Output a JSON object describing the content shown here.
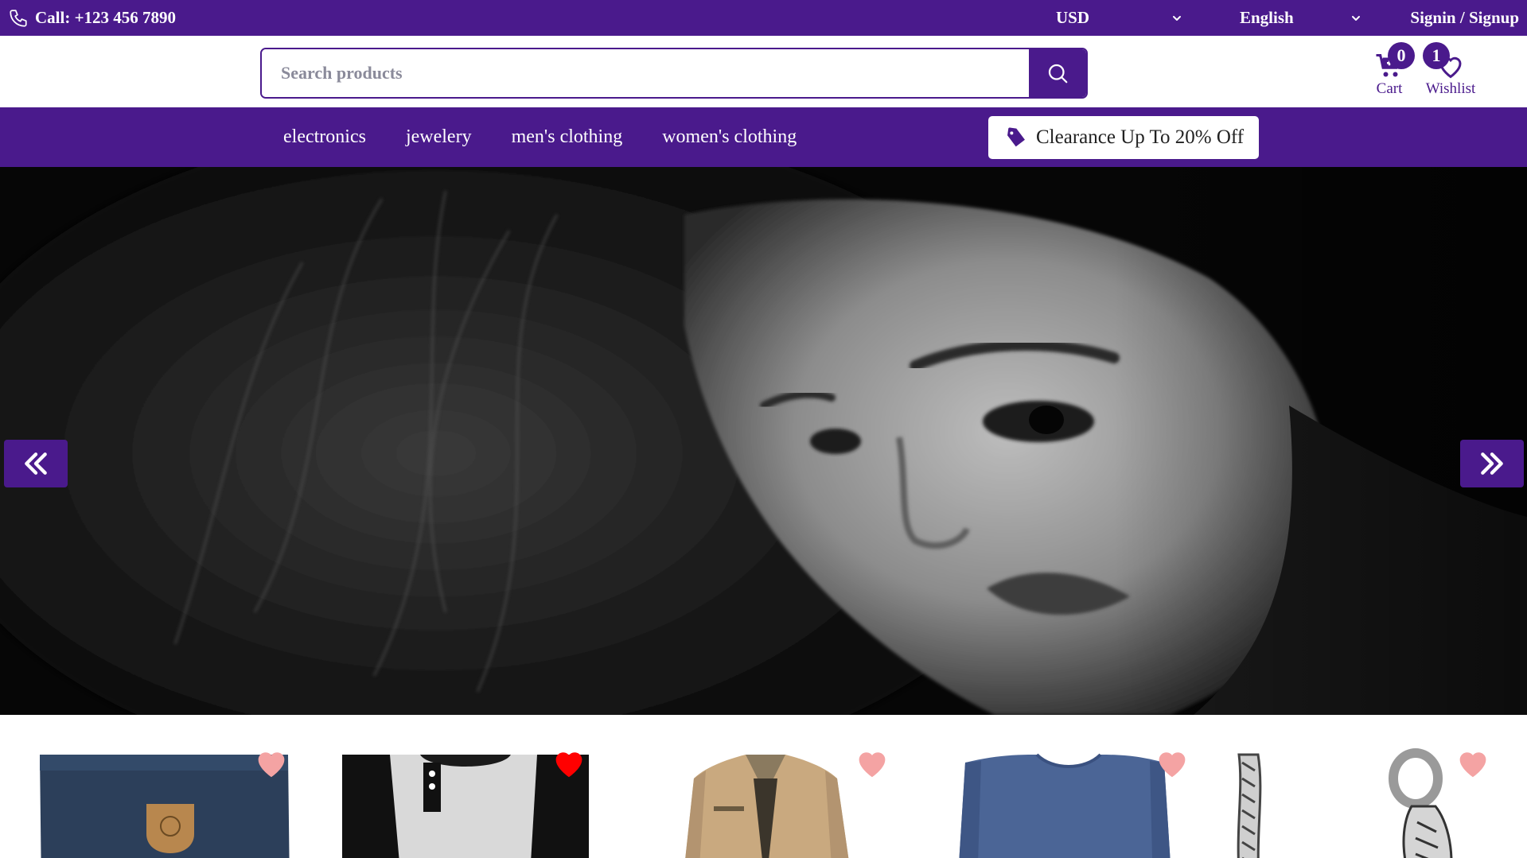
{
  "topbar": {
    "call_label": "Call: +123 456 7890",
    "currency": "USD",
    "language": "English",
    "signin_label": "Signin / Signup",
    "icons": [
      "phone-icon",
      "chevron-down-icon",
      "chevron-down-icon"
    ]
  },
  "header": {
    "search_placeholder": "Search products",
    "search_value": "",
    "cart_label": "Cart",
    "cart_count": "0",
    "wishlist_label": "Wishlist",
    "wishlist_count": "1",
    "icons": [
      "search-icon",
      "cart-icon",
      "heart-outline-icon"
    ]
  },
  "nav": {
    "categories": [
      "electronics",
      "jewelery",
      "men's clothing",
      "women's clothing"
    ],
    "promo_label": "Clearance Up To 20% Off",
    "promo_icon": "tag-icon"
  },
  "hero": {
    "image": "black-and-white portrait photo of a woman",
    "prev_icon": "double-chevron-left-icon",
    "next_icon": "double-chevron-right-icon"
  },
  "products": {
    "items": [
      {
        "image": "navy backpack with leather fox logo patch",
        "wishlisted": false
      },
      {
        "image": "raglan henley long-sleeve shirt, grey and black",
        "wishlisted": true
      },
      {
        "image": "khaki cotton jacket",
        "wishlisted": false
      },
      {
        "image": "blue slim-fit long-sleeve tee",
        "wishlisted": false
      },
      {
        "image": "silver dragon chain bracelet",
        "wishlisted": false
      }
    ]
  },
  "colors": {
    "brand_purple": "#4a1a8c",
    "heart_active": "#ff0000",
    "heart_inactive": "#f4a3a3",
    "white": "#ffffff"
  }
}
